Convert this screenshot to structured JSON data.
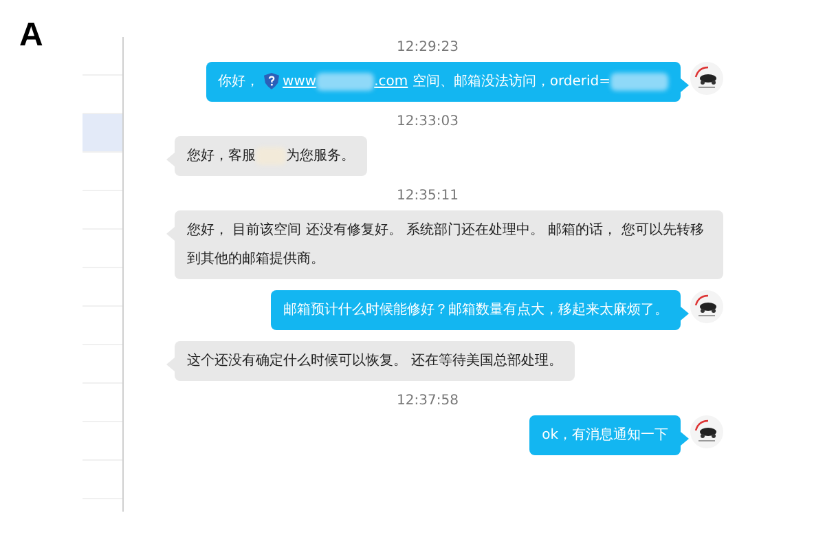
{
  "panel_label": "A",
  "sidebar": {
    "items": [
      {
        "selected": false
      },
      {
        "selected": false
      },
      {
        "selected": true
      },
      {
        "selected": false
      },
      {
        "selected": false
      },
      {
        "selected": false
      },
      {
        "selected": false
      },
      {
        "selected": false
      },
      {
        "selected": false
      },
      {
        "selected": false
      },
      {
        "selected": false
      },
      {
        "selected": false
      }
    ]
  },
  "messages": [
    {
      "kind": "time",
      "text": "12:29:23"
    },
    {
      "kind": "sent",
      "parts": [
        {
          "kind": "text",
          "text": "你好，"
        },
        {
          "kind": "icon"
        },
        {
          "kind": "link",
          "text": "www"
        },
        {
          "kind": "redacted"
        },
        {
          "kind": "link",
          "text": ".com"
        },
        {
          "kind": "text",
          "text": " 空间、邮箱没法访问，orderid="
        },
        {
          "kind": "redacted"
        }
      ]
    },
    {
      "kind": "time",
      "text": "12:33:03"
    },
    {
      "kind": "received",
      "parts": [
        {
          "kind": "text",
          "text": "您好，客服"
        },
        {
          "kind": "redacted"
        },
        {
          "kind": "text",
          "text": "为您服务。"
        }
      ]
    },
    {
      "kind": "time",
      "text": "12:35:11"
    },
    {
      "kind": "received",
      "parts": [
        {
          "kind": "text",
          "text": "您好， 目前该空间 还没有修复好。 系统部门还在处理中。 邮箱的话， 您可以先转移到其他的邮箱提供商。"
        }
      ]
    },
    {
      "kind": "sent",
      "parts": [
        {
          "kind": "text",
          "text": "邮箱预计什么时候能修好？邮箱数量有点大，移起来太麻烦了。"
        }
      ]
    },
    {
      "kind": "received",
      "parts": [
        {
          "kind": "text",
          "text": "这个还没有确定什么时候可以恢复。 还在等待美国总部处理。"
        }
      ]
    },
    {
      "kind": "time",
      "text": "12:37:58"
    },
    {
      "kind": "sent",
      "parts": [
        {
          "kind": "text",
          "text": "ok，有消息通知一下"
        }
      ]
    }
  ]
}
